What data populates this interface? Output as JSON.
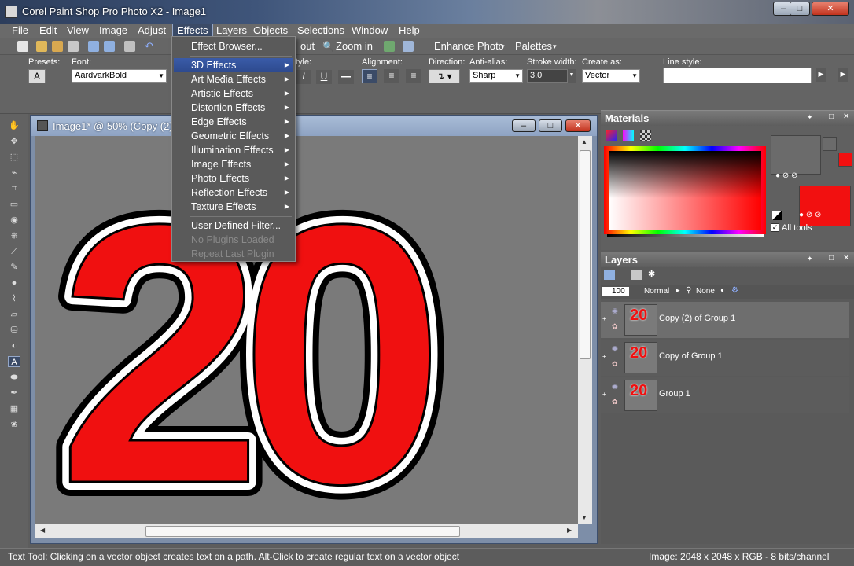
{
  "window": {
    "title": "Corel Paint Shop Pro Photo X2 - Image1"
  },
  "menubar": {
    "items": [
      "File",
      "Edit",
      "View",
      "Image",
      "Adjust",
      "Effects",
      "Layers",
      "Objects",
      "Selections",
      "Window",
      "Help"
    ],
    "active": "Effects"
  },
  "toolbar": {
    "zoom_out": "out",
    "zoom_in": "Zoom in",
    "enhance_photo": "Enhance Photo",
    "palettes": "Palettes"
  },
  "options": {
    "presets_label": "Presets:",
    "font_label": "Font:",
    "font_value": "AardvarkBold",
    "style_label": "tyle:",
    "alignment_label": "Alignment:",
    "direction_label": "Direction:",
    "antialias_label": "Anti-alias:",
    "antialias_value": "Sharp",
    "stroke_label": "Stroke width:",
    "stroke_value": "3.0",
    "createas_label": "Create as:",
    "createas_value": "Vector",
    "linestyle_label": "Line style:"
  },
  "document": {
    "title": "Image1* @  50% (Copy (2) o",
    "canvas_text": "20",
    "text_fill": "#f01010"
  },
  "effects_menu": {
    "items": [
      {
        "label": "Effect Browser...",
        "submenu": false,
        "disabled": false
      },
      {
        "label": "3D Effects",
        "submenu": true,
        "disabled": false,
        "highlighted": true
      },
      {
        "label": "Art Media Effects",
        "submenu": true,
        "disabled": false
      },
      {
        "label": "Artistic Effects",
        "submenu": true,
        "disabled": false
      },
      {
        "label": "Distortion Effects",
        "submenu": true,
        "disabled": false
      },
      {
        "label": "Edge Effects",
        "submenu": true,
        "disabled": false
      },
      {
        "label": "Geometric Effects",
        "submenu": true,
        "disabled": false
      },
      {
        "label": "Illumination Effects",
        "submenu": true,
        "disabled": false
      },
      {
        "label": "Image Effects",
        "submenu": true,
        "disabled": false
      },
      {
        "label": "Photo Effects",
        "submenu": true,
        "disabled": false
      },
      {
        "label": "Reflection Effects",
        "submenu": true,
        "disabled": false
      },
      {
        "label": "Texture Effects",
        "submenu": true,
        "disabled": false
      },
      {
        "label": "User Defined Filter...",
        "submenu": false,
        "disabled": false
      },
      {
        "label": "No Plugins Loaded",
        "submenu": false,
        "disabled": true
      },
      {
        "label": "Repeat Last Plugin",
        "submenu": false,
        "disabled": true
      }
    ]
  },
  "materials": {
    "title": "Materials",
    "all_tools_label": "All tools",
    "fg_color": "#6b6b6b",
    "bg_color": "#f21010"
  },
  "layers": {
    "title": "Layers",
    "opacity": "100",
    "blend_mode": "Normal",
    "mask": "None",
    "rows": [
      {
        "name": "Copy (2) of Group 1",
        "thumb": "20",
        "selected": true
      },
      {
        "name": "Copy of Group 1",
        "thumb": "20",
        "selected": false
      },
      {
        "name": "Group 1",
        "thumb": "20",
        "selected": false
      }
    ]
  },
  "status": {
    "left": "Text Tool: Clicking on a vector object creates text on a path. Alt-Click to create regular text on a vector object",
    "right": "Image:  2048 x 2048 x RGB - 8 bits/channel"
  }
}
